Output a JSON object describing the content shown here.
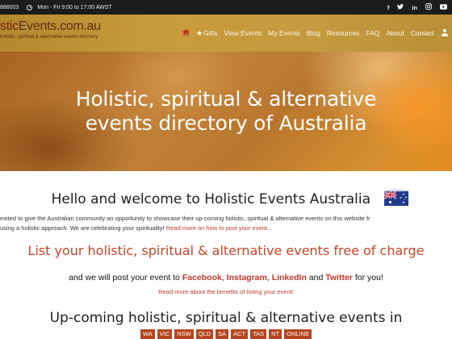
{
  "topbar": {
    "phone": "888003",
    "hours": "Mon - Fri 9:00 to 17:00 AWST",
    "social": [
      "f",
      "t",
      "in",
      "ig",
      "yt"
    ]
  },
  "header": {
    "logo_part1": "stic",
    "logo_part2": "Events.com.au",
    "tagline": "holistic, spiritual & alternative events directory",
    "nav": [
      "Gifts",
      "View Events",
      "My Events",
      "Blog",
      "Resources",
      "FAQ",
      "About",
      "Contact"
    ],
    "icons": [
      "home-icon",
      "star-icon",
      "user-icon"
    ]
  },
  "hero": {
    "line1": "Holistic, spiritual & alternative",
    "line2": "events directory of Australia"
  },
  "main": {
    "welcome": "Hello and welcome to Holistic Events Australia",
    "intro_line1": "exited to give the Australian community an opportunity to showcase their up-coming holistic, spiritual & alternative events on this website fr",
    "intro_line2": "using a holistic approach. We are celebrating your spirituality!",
    "intro_link": "Read more on how to post your event...",
    "list_heading": "List your holistic, spiritual & alternative events free of charge",
    "post_prefix": "and we will post your event to",
    "post_facebook": "Facebook",
    "post_instagram": "Instagram",
    "post_linkedin": "LinkedIn",
    "post_and": "and",
    "post_twitter": "Twitter",
    "post_suffix": "for you!",
    "readmore_listing": "Read more about the benefits of listing your event!",
    "upcoming": "Up-coming holistic, spiritual & alternative events in",
    "states": [
      "WA",
      "VIC",
      "NSW",
      "QLD",
      "SA",
      "ACT",
      "TAS",
      "NT",
      "ONLINE"
    ]
  },
  "colors": {
    "accent_red": "#c64528",
    "header_gold": "#c59a3f",
    "topbar": "#1c1c1c"
  }
}
